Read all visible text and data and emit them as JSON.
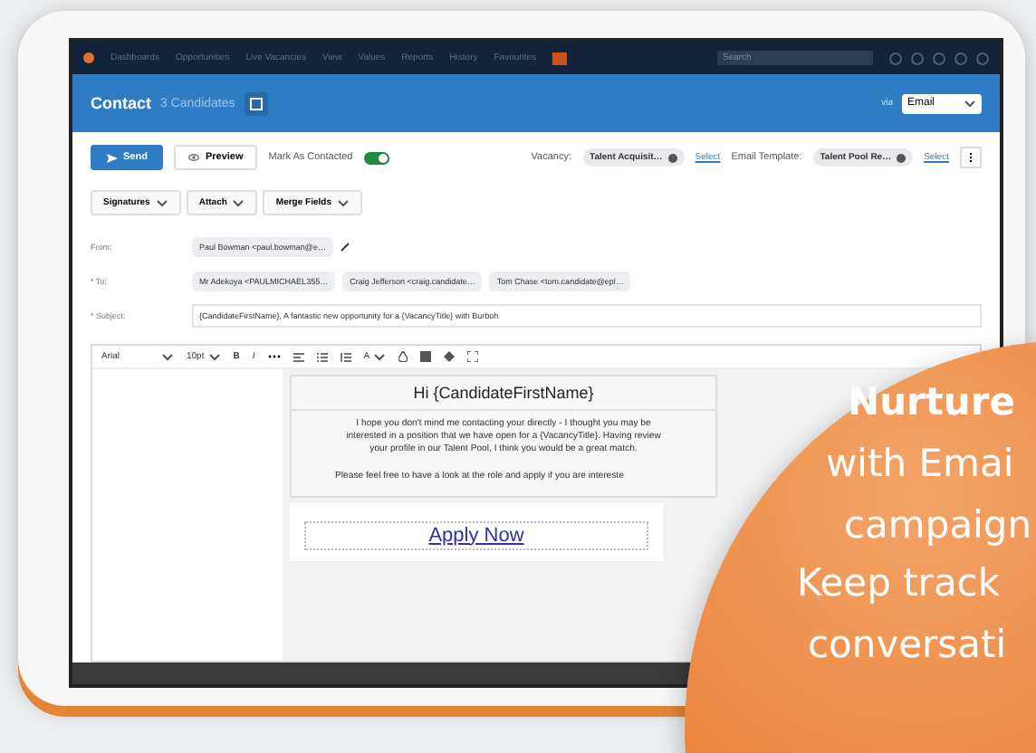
{
  "nav": {
    "items": [
      "Dashboards",
      "Opportunities",
      "Live Vacancies",
      "View",
      "Values",
      "Reports",
      "History",
      "Favourites"
    ],
    "search": {
      "placeholder": "Search"
    }
  },
  "header": {
    "title": "Contact",
    "count": "3 Candidates",
    "via_label": "via",
    "channel": "Email"
  },
  "toolbar": {
    "send": "Send",
    "preview": "Preview",
    "mark_label": "Mark As Contacted",
    "mark_on": true,
    "vacancy_label": "Vacancy:",
    "vacancy": "Talent Acquisit…",
    "vacancy_link": "Select",
    "template_label": "Email Template:",
    "template": "Talent Pool Re…",
    "template_link": "Select"
  },
  "compose_buttons": [
    "Signatures",
    "Attach",
    "Merge Fields"
  ],
  "from": {
    "label": "From:",
    "value": "Paul Bowman <paul.bowman@e…"
  },
  "to": {
    "label": "* To:",
    "recipients": [
      "Mr Adekoya <PAULMICHAEL355…",
      "Craig Jefferson <craig.candidate…",
      "Tom Chase <tom.candidate@epl…"
    ]
  },
  "subject": {
    "label": "* Subject:",
    "value": "{CandidateFirstName}, A fantastic new opportunity for a {VacancyTitle} with Burboh"
  },
  "editor_toolbar": {
    "font": "Arial",
    "size": "10pt",
    "bold": "B",
    "italic": "I",
    "font_color": "A"
  },
  "email": {
    "greeting": "Hi {CandidateFirstName}",
    "paragraph_lines": [
      "I hope you don't mind me contacting your directly - I thought you may be",
      "interested in a position that we have open for a {VacancyTitle}. Having review",
      "your profile in our Talent Pool, I think you would be a great match."
    ],
    "closing": "Please feel free to have a look at the role and apply if you are intereste",
    "cta": "Apply Now"
  },
  "promo": {
    "lines": [
      "Nurture",
      "with Emai",
      "campaign",
      "Keep track",
      "conversati"
    ]
  }
}
